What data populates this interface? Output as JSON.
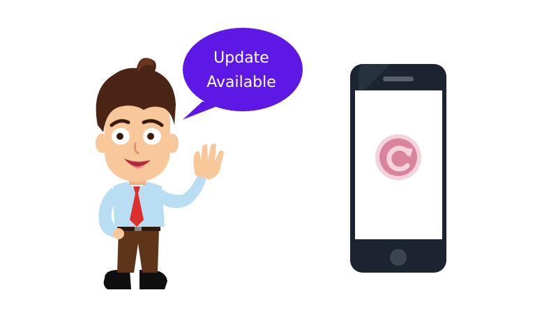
{
  "speech_bubble": {
    "line1": "Update",
    "line2": "Available",
    "color": "#5d18e6"
  },
  "phone": {
    "body_color": "#1b2430",
    "screen_color": "#ffffff",
    "icon": "refresh-icon",
    "icon_color": "#d9839f"
  },
  "character": {
    "pose": "waving",
    "hair_color": "#4a2414",
    "shirt_color": "#b9ddf3",
    "tie_color": "#dd2f2b",
    "pants_color": "#5e3519"
  }
}
